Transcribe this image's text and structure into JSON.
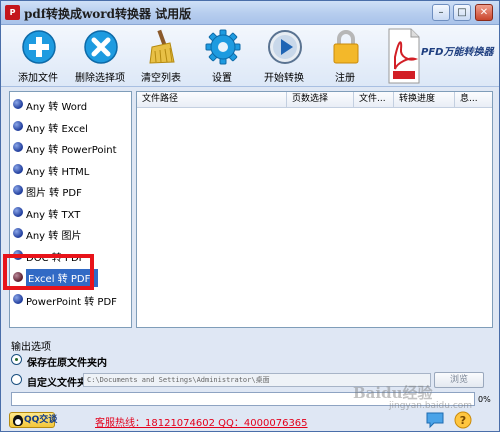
{
  "window": {
    "title": "pdf转换成word转换器 试用版",
    "app_icon_text": "P",
    "minimize": "–",
    "maximize": "□",
    "close": "✕"
  },
  "toolbar": {
    "buttons": [
      {
        "label": "添加文件",
        "icon": "add-icon"
      },
      {
        "label": "删除选择项",
        "icon": "delete-icon"
      },
      {
        "label": "清空列表",
        "icon": "broom-icon"
      },
      {
        "label": "设置",
        "icon": "gear-icon"
      },
      {
        "label": "开始转换",
        "icon": "play-icon"
      },
      {
        "label": "注册",
        "icon": "lock-icon"
      }
    ],
    "brand": "PFD万能转换器",
    "brand_icon": "pdf-icon"
  },
  "modes": {
    "items": [
      {
        "label": "Any 转 Word"
      },
      {
        "label": "Any 转 Excel"
      },
      {
        "label": "Any 转 PowerPoint"
      },
      {
        "label": "Any 转 HTML"
      },
      {
        "label": "图片 转 PDF"
      },
      {
        "label": "Any 转 TXT"
      },
      {
        "label": "Any 转 图片"
      },
      {
        "label": "DOC 转 PDF"
      },
      {
        "label": "Excel 转 PDF"
      },
      {
        "label": "PowerPoint 转 PDF"
      }
    ],
    "selected": "Excel 转 PDF"
  },
  "table": {
    "columns": [
      "文件路径",
      "页数选择",
      "文件...",
      "转换进度",
      "息..."
    ],
    "rows": []
  },
  "output": {
    "title": "输出选项",
    "option_same_folder": "保存在原文件夹内",
    "option_custom_folder": "自定义文件夹",
    "custom_path": "C:\\Documents and Settings\\Administrator\\桌面",
    "browse_label": "浏览",
    "selected_option": "保存在原文件夹内"
  },
  "progress": {
    "value": 0,
    "percent_text": "0%"
  },
  "statusbar": {
    "qq_label": "QQ交谈",
    "hotline": "客服热线：18121074602 QQ：4000076365"
  },
  "watermark": {
    "text": "Baidu经验",
    "subtext": "jingyan.baidu.com"
  }
}
